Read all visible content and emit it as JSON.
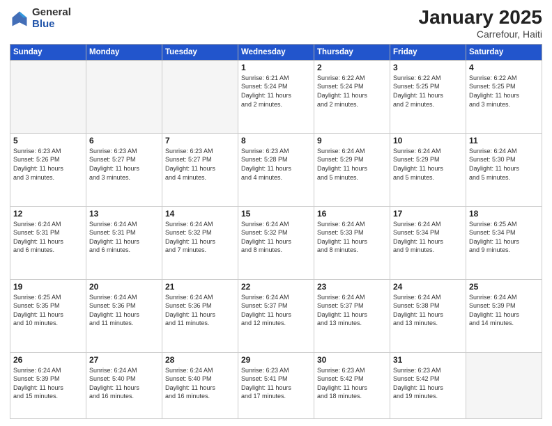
{
  "logo": {
    "general": "General",
    "blue": "Blue"
  },
  "title": "January 2025",
  "subtitle": "Carrefour, Haiti",
  "days_of_week": [
    "Sunday",
    "Monday",
    "Tuesday",
    "Wednesday",
    "Thursday",
    "Friday",
    "Saturday"
  ],
  "weeks": [
    [
      {
        "day": "",
        "info": ""
      },
      {
        "day": "",
        "info": ""
      },
      {
        "day": "",
        "info": ""
      },
      {
        "day": "1",
        "info": "Sunrise: 6:21 AM\nSunset: 5:24 PM\nDaylight: 11 hours\nand 2 minutes."
      },
      {
        "day": "2",
        "info": "Sunrise: 6:22 AM\nSunset: 5:24 PM\nDaylight: 11 hours\nand 2 minutes."
      },
      {
        "day": "3",
        "info": "Sunrise: 6:22 AM\nSunset: 5:25 PM\nDaylight: 11 hours\nand 2 minutes."
      },
      {
        "day": "4",
        "info": "Sunrise: 6:22 AM\nSunset: 5:25 PM\nDaylight: 11 hours\nand 3 minutes."
      }
    ],
    [
      {
        "day": "5",
        "info": "Sunrise: 6:23 AM\nSunset: 5:26 PM\nDaylight: 11 hours\nand 3 minutes."
      },
      {
        "day": "6",
        "info": "Sunrise: 6:23 AM\nSunset: 5:27 PM\nDaylight: 11 hours\nand 3 minutes."
      },
      {
        "day": "7",
        "info": "Sunrise: 6:23 AM\nSunset: 5:27 PM\nDaylight: 11 hours\nand 4 minutes."
      },
      {
        "day": "8",
        "info": "Sunrise: 6:23 AM\nSunset: 5:28 PM\nDaylight: 11 hours\nand 4 minutes."
      },
      {
        "day": "9",
        "info": "Sunrise: 6:24 AM\nSunset: 5:29 PM\nDaylight: 11 hours\nand 5 minutes."
      },
      {
        "day": "10",
        "info": "Sunrise: 6:24 AM\nSunset: 5:29 PM\nDaylight: 11 hours\nand 5 minutes."
      },
      {
        "day": "11",
        "info": "Sunrise: 6:24 AM\nSunset: 5:30 PM\nDaylight: 11 hours\nand 5 minutes."
      }
    ],
    [
      {
        "day": "12",
        "info": "Sunrise: 6:24 AM\nSunset: 5:31 PM\nDaylight: 11 hours\nand 6 minutes."
      },
      {
        "day": "13",
        "info": "Sunrise: 6:24 AM\nSunset: 5:31 PM\nDaylight: 11 hours\nand 6 minutes."
      },
      {
        "day": "14",
        "info": "Sunrise: 6:24 AM\nSunset: 5:32 PM\nDaylight: 11 hours\nand 7 minutes."
      },
      {
        "day": "15",
        "info": "Sunrise: 6:24 AM\nSunset: 5:32 PM\nDaylight: 11 hours\nand 8 minutes."
      },
      {
        "day": "16",
        "info": "Sunrise: 6:24 AM\nSunset: 5:33 PM\nDaylight: 11 hours\nand 8 minutes."
      },
      {
        "day": "17",
        "info": "Sunrise: 6:24 AM\nSunset: 5:34 PM\nDaylight: 11 hours\nand 9 minutes."
      },
      {
        "day": "18",
        "info": "Sunrise: 6:25 AM\nSunset: 5:34 PM\nDaylight: 11 hours\nand 9 minutes."
      }
    ],
    [
      {
        "day": "19",
        "info": "Sunrise: 6:25 AM\nSunset: 5:35 PM\nDaylight: 11 hours\nand 10 minutes."
      },
      {
        "day": "20",
        "info": "Sunrise: 6:24 AM\nSunset: 5:36 PM\nDaylight: 11 hours\nand 11 minutes."
      },
      {
        "day": "21",
        "info": "Sunrise: 6:24 AM\nSunset: 5:36 PM\nDaylight: 11 hours\nand 11 minutes."
      },
      {
        "day": "22",
        "info": "Sunrise: 6:24 AM\nSunset: 5:37 PM\nDaylight: 11 hours\nand 12 minutes."
      },
      {
        "day": "23",
        "info": "Sunrise: 6:24 AM\nSunset: 5:37 PM\nDaylight: 11 hours\nand 13 minutes."
      },
      {
        "day": "24",
        "info": "Sunrise: 6:24 AM\nSunset: 5:38 PM\nDaylight: 11 hours\nand 13 minutes."
      },
      {
        "day": "25",
        "info": "Sunrise: 6:24 AM\nSunset: 5:39 PM\nDaylight: 11 hours\nand 14 minutes."
      }
    ],
    [
      {
        "day": "26",
        "info": "Sunrise: 6:24 AM\nSunset: 5:39 PM\nDaylight: 11 hours\nand 15 minutes."
      },
      {
        "day": "27",
        "info": "Sunrise: 6:24 AM\nSunset: 5:40 PM\nDaylight: 11 hours\nand 16 minutes."
      },
      {
        "day": "28",
        "info": "Sunrise: 6:24 AM\nSunset: 5:40 PM\nDaylight: 11 hours\nand 16 minutes."
      },
      {
        "day": "29",
        "info": "Sunrise: 6:23 AM\nSunset: 5:41 PM\nDaylight: 11 hours\nand 17 minutes."
      },
      {
        "day": "30",
        "info": "Sunrise: 6:23 AM\nSunset: 5:42 PM\nDaylight: 11 hours\nand 18 minutes."
      },
      {
        "day": "31",
        "info": "Sunrise: 6:23 AM\nSunset: 5:42 PM\nDaylight: 11 hours\nand 19 minutes."
      },
      {
        "day": "",
        "info": ""
      }
    ]
  ]
}
